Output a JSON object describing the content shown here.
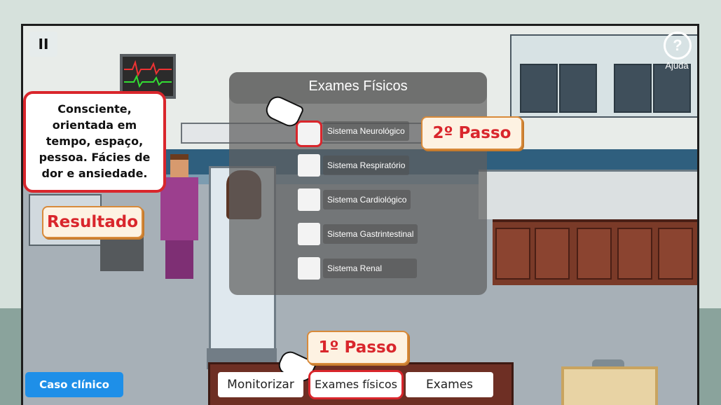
{
  "hud": {
    "pause_icon": "pause-icon",
    "pause_glyph": "II",
    "help_glyph": "?",
    "help_label": "Ajuda"
  },
  "panel": {
    "title": "Exames Físicos",
    "options": [
      {
        "label": "Sistema Neurológico",
        "checked": false,
        "highlighted": true
      },
      {
        "label": "Sistema Respiratório",
        "checked": false,
        "highlighted": false
      },
      {
        "label": "Sistema Cardiológico",
        "checked": false,
        "highlighted": false
      },
      {
        "label": "Sistema Gastrintestinal",
        "checked": false,
        "highlighted": false
      },
      {
        "label": "Sistema Renal",
        "checked": false,
        "highlighted": false
      }
    ]
  },
  "result": {
    "text": "Consciente, orientada em tempo, espaço, pessoa. Fácies de dor e ansiedade.",
    "label": "Resultado"
  },
  "steps": {
    "step1": "1º Passo",
    "step2": "2º Passo"
  },
  "actions": {
    "case_button": "Caso clínico",
    "monitor_button": "Monitorizar",
    "physical_exams_button": "Exames físicos",
    "exams_button": "Exames"
  },
  "colors": {
    "highlight": "#d9262c",
    "case_button": "#1e8fe8",
    "step_tag_bg": "#fdf2e2"
  }
}
